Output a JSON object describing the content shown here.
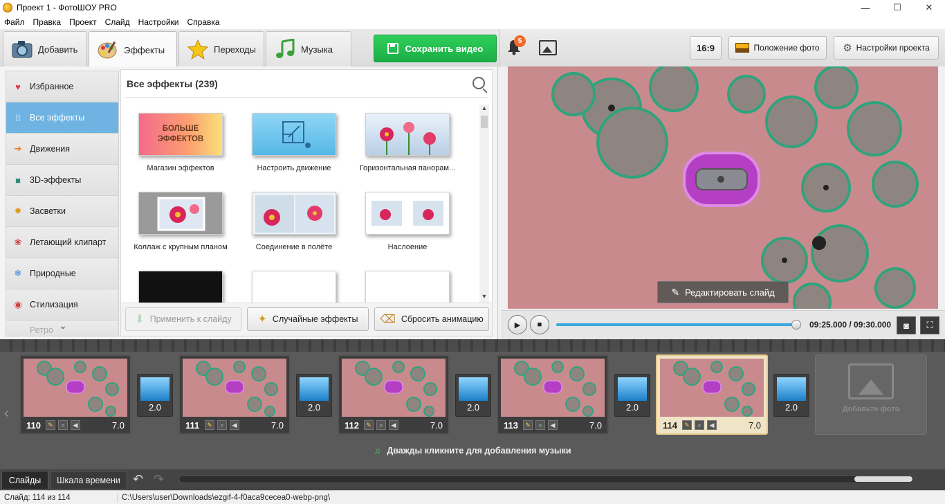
{
  "window": {
    "title": "Проект 1 - ФотоШОУ PRO",
    "controls": [
      "—",
      "☐",
      "✕"
    ]
  },
  "menu": [
    "Файл",
    "Правка",
    "Проект",
    "Слайд",
    "Настройки",
    "Справка"
  ],
  "tabs": [
    {
      "label": "Добавить",
      "icon": "camera-icon"
    },
    {
      "label": "Эффекты",
      "icon": "palette-icon"
    },
    {
      "label": "Переходы",
      "icon": "star-icon"
    },
    {
      "label": "Музыка",
      "icon": "music-note-icon"
    }
  ],
  "toolbar": {
    "save_label": "Сохранить видео",
    "notifications_count": "5",
    "aspect_label": "16:9",
    "photo_position_label": "Положение фото",
    "project_settings_label": "Настройки проекта"
  },
  "categories": [
    {
      "label": "Избранное",
      "icon": "heart-icon",
      "color": "#e03b4b"
    },
    {
      "label": "Все эффекты",
      "icon": "grid-dots-icon",
      "color": "#ffffff"
    },
    {
      "label": "Движения",
      "icon": "arrow-right-icon",
      "color": "#f07a1a"
    },
    {
      "label": "3D-эффекты",
      "icon": "cube-icon",
      "color": "#2d8a7a"
    },
    {
      "label": "Засветки",
      "icon": "sun-icon",
      "color": "#e09a1a"
    },
    {
      "label": "Летающий клипарт",
      "icon": "balloons-icon",
      "color": "#d04040"
    },
    {
      "label": "Природные",
      "icon": "snowflake-icon",
      "color": "#3a8ae0"
    },
    {
      "label": "Стилизация",
      "icon": "chrome-icon",
      "color": "#d04040"
    },
    {
      "label": "Ретро",
      "icon": "retro-icon",
      "color": "#aaaaaa"
    }
  ],
  "effects": {
    "header": "Все эффекты (239)",
    "items": [
      {
        "label": "Магазин эффектов",
        "thumb_text": "БОЛЬШЕ ЭФФЕКТОВ"
      },
      {
        "label": "Настроить движение"
      },
      {
        "label": "Горизонтальная панорам..."
      },
      {
        "label": "Коллаж с крупным планом"
      },
      {
        "label": "Соединение в полёте"
      },
      {
        "label": "Наслоение"
      }
    ],
    "apply_label": "Применить к слайду",
    "random_label": "Случайные эффекты",
    "reset_label": "Сбросить анимацию"
  },
  "preview": {
    "edit_slide_label": "Редактировать слайд",
    "time": "09:25.000 / 09:30.000",
    "progress": 0.985
  },
  "slides": [
    {
      "number": "110",
      "duration": "7.0"
    },
    {
      "number": "111",
      "duration": "7.0"
    },
    {
      "number": "112",
      "duration": "7.0"
    },
    {
      "number": "113",
      "duration": "7.0"
    },
    {
      "number": "114",
      "duration": "7.0",
      "active": true
    }
  ],
  "transitions": [
    "2.0",
    "2.0",
    "2.0",
    "2.0",
    "2.0"
  ],
  "filmstrip": {
    "add_photo_label": "Добавьте фото",
    "music_hint": "Дважды кликните для добавления музыки"
  },
  "bottom": {
    "tab_slides": "Слайды",
    "tab_timeline": "Шкала времени"
  },
  "status": {
    "slide_info": "Слайд: 114 из 114",
    "path": "C:\\Users\\user\\Downloads\\ezgif-4-f0aca9cecea0-webp-png\\"
  }
}
